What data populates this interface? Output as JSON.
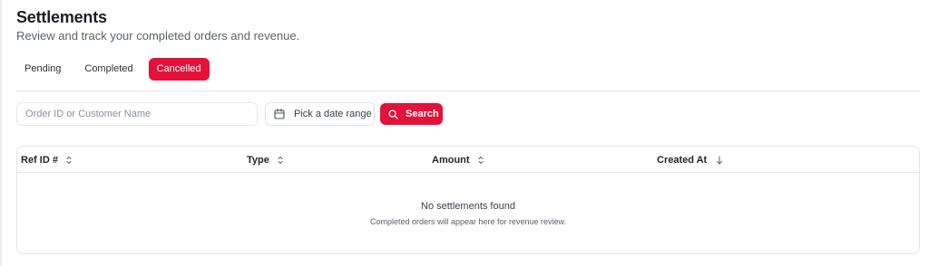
{
  "header": {
    "title": "Settlements",
    "subtitle": "Review and track your completed orders and revenue."
  },
  "tabs": [
    {
      "label": "Pending",
      "active": false
    },
    {
      "label": "Completed",
      "active": false
    },
    {
      "label": "Cancelled",
      "active": true
    }
  ],
  "filters": {
    "search_placeholder": "Order ID or Customer Name",
    "search_value": "",
    "date_range_label": "Pick a date range",
    "search_button_label": "Search"
  },
  "table": {
    "columns": [
      {
        "label": "Ref ID #",
        "sort": "unsorted"
      },
      {
        "label": "Type",
        "sort": "unsorted"
      },
      {
        "label": "Amount",
        "sort": "unsorted"
      },
      {
        "label": "Created At",
        "sort": "descending"
      }
    ],
    "rows": [],
    "empty_title": "No settlements found",
    "empty_description": "Completed orders will appear here for revenue review."
  },
  "colors": {
    "accent": "#e4113b",
    "border": "#e3e5e8",
    "text": "#1f2328",
    "muted_text": "#5c6169"
  }
}
